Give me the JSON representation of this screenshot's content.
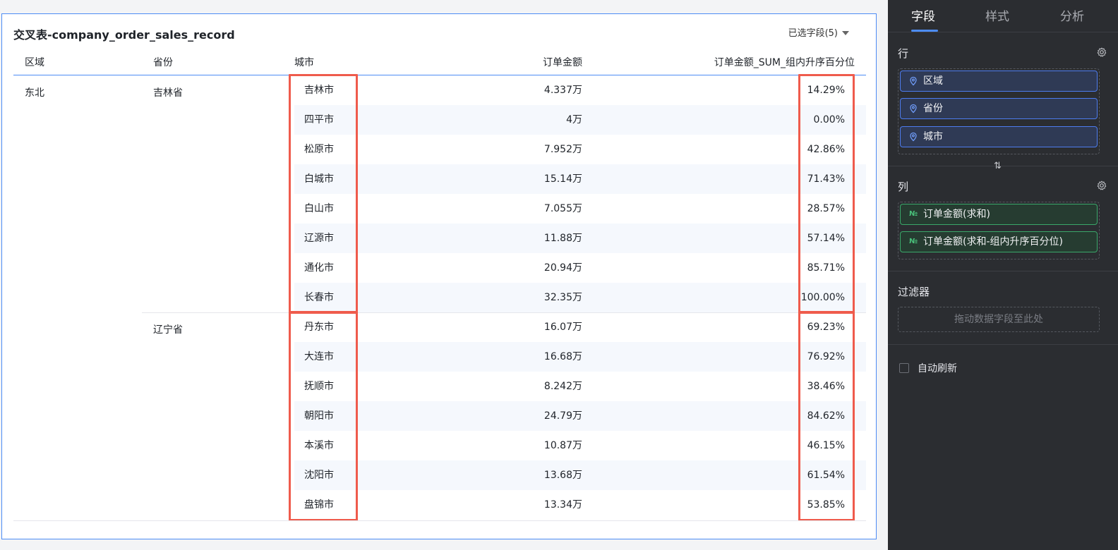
{
  "card": {
    "title": "交叉表-company_order_sales_record",
    "field_selector": "已选字段(5)"
  },
  "table": {
    "headers": {
      "region": "区域",
      "province": "省份",
      "city": "城市",
      "amount": "订单金额",
      "percentile": "订单金额_SUM_组内升序百分位"
    },
    "region": "东北",
    "groups": [
      {
        "province": "吉林省",
        "rows": [
          {
            "city": "吉林市",
            "amount": "4.337万",
            "pct": "14.29%"
          },
          {
            "city": "四平市",
            "amount": "4万",
            "pct": "0.00%"
          },
          {
            "city": "松原市",
            "amount": "7.952万",
            "pct": "42.86%"
          },
          {
            "city": "白城市",
            "amount": "15.14万",
            "pct": "71.43%"
          },
          {
            "city": "白山市",
            "amount": "7.055万",
            "pct": "28.57%"
          },
          {
            "city": "辽源市",
            "amount": "11.88万",
            "pct": "57.14%"
          },
          {
            "city": "通化市",
            "amount": "20.94万",
            "pct": "85.71%"
          },
          {
            "city": "长春市",
            "amount": "32.35万",
            "pct": "100.00%"
          }
        ]
      },
      {
        "province": "辽宁省",
        "rows": [
          {
            "city": "丹东市",
            "amount": "16.07万",
            "pct": "69.23%"
          },
          {
            "city": "大连市",
            "amount": "16.68万",
            "pct": "76.92%"
          },
          {
            "city": "抚顺市",
            "amount": "8.242万",
            "pct": "38.46%"
          },
          {
            "city": "朝阳市",
            "amount": "24.79万",
            "pct": "84.62%"
          },
          {
            "city": "本溪市",
            "amount": "10.87万",
            "pct": "46.15%"
          },
          {
            "city": "沈阳市",
            "amount": "13.68万",
            "pct": "61.54%"
          },
          {
            "city": "盘锦市",
            "amount": "13.34万",
            "pct": "53.85%"
          }
        ]
      }
    ]
  },
  "panel": {
    "tabs": [
      {
        "label": "字段",
        "active": true
      },
      {
        "label": "样式",
        "active": false
      },
      {
        "label": "分析",
        "active": false
      }
    ],
    "rows_title": "行",
    "row_fields": [
      "区域",
      "省份",
      "城市"
    ],
    "cols_title": "列",
    "col_fields": [
      "订单金额(求和)",
      "订单金额(求和-组内升序百分位)"
    ],
    "swap_icon": "⇅",
    "filter_title": "过滤器",
    "filter_placeholder": "拖动数据字段至此处",
    "auto_refresh_label": "自动刷新",
    "auto_refresh_checked": false
  },
  "colors": {
    "highlight": "#ef5b4c",
    "accent": "#4d8cf5",
    "panel_bg": "#2b2d31"
  }
}
